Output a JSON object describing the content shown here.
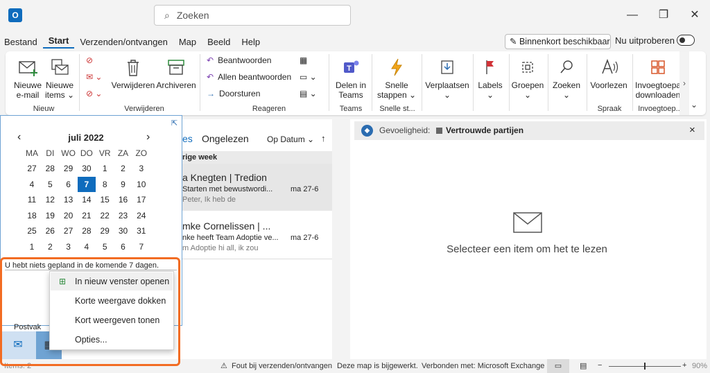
{
  "app": {
    "icon_letter": "O",
    "search_placeholder": "Zoeken"
  },
  "window": {
    "minimize": "—",
    "maximize": "❐",
    "close": "✕"
  },
  "menu": {
    "items": [
      "Bestand",
      "Start",
      "Verzenden/ontvangen",
      "Map",
      "Beeld",
      "Help"
    ],
    "active": "Start",
    "soon": "Binnenkort beschikbaar",
    "tryout": "Nu uitproberen"
  },
  "ribbon": {
    "new": {
      "new_email": "Nieuwe e-mail",
      "new_items": "Nieuwe items ⌄",
      "group": "Nieuw"
    },
    "delete": {
      "delete": "Verwijderen",
      "archive": "Archiveren",
      "group": "Verwijderen"
    },
    "respond": {
      "reply": "Beantwoorden",
      "reply_all": "Allen beantwoorden",
      "forward": "Doorsturen",
      "group": "Reageren"
    },
    "teams": {
      "share": "Delen in Teams",
      "group": "Teams"
    },
    "quicksteps": {
      "label": "Snelle stappen ⌄",
      "group": "Snelle st..."
    },
    "move": {
      "label": "Verplaatsen ⌄"
    },
    "tags": {
      "label": "Labels ⌄"
    },
    "groups": {
      "label": "Groepen ⌄"
    },
    "find": {
      "label": "Zoeken ⌄"
    },
    "speech": {
      "label": "Voorlezen",
      "group": "Spraak"
    },
    "addins": {
      "label": "Invoegtoepassingen downloaden",
      "group": "Invoegtoep..."
    }
  },
  "calendar": {
    "month": "juli 2022",
    "prev": "‹",
    "next": "›",
    "days": [
      "MA",
      "DI",
      "WO",
      "DO",
      "VR",
      "ZA",
      "ZO"
    ],
    "weeks": [
      [
        "27",
        "28",
        "29",
        "30",
        "1",
        "2",
        "3"
      ],
      [
        "4",
        "5",
        "6",
        "7",
        "8",
        "9",
        "10"
      ],
      [
        "11",
        "12",
        "13",
        "14",
        "15",
        "16",
        "17"
      ],
      [
        "18",
        "19",
        "20",
        "21",
        "22",
        "23",
        "24"
      ],
      [
        "25",
        "26",
        "27",
        "28",
        "29",
        "30",
        "31"
      ],
      [
        "1",
        "2",
        "3",
        "4",
        "5",
        "6",
        "7"
      ]
    ],
    "today": "7",
    "agenda": "U hebt niets gepland in de komende 7 dagen."
  },
  "maillist": {
    "tab_all": "es",
    "tab_unread": "Ongelezen",
    "sort": "Op Datum ⌄",
    "sort_dir": "↑",
    "section": "rige week",
    "items": [
      {
        "sender": "a Knegten | Tredion",
        "subject": "Starten met bewustwordi...",
        "date": "ma 27-6",
        "preview": "Peter,    Ik heb de"
      },
      {
        "sender": "mke Cornelissen | ...",
        "subject": "nke heeft Team Adoptie ve...",
        "date": "ma 27-6",
        "preview": "m Adoptie  hi all, ik zou"
      }
    ]
  },
  "reading": {
    "sensitivity_label": "Gevoeligheid:",
    "sensitivity_value": "Vertrouwde partijen",
    "close": "×",
    "empty": "Selecteer een item om het te lezen"
  },
  "nav": {
    "folder": "Postvak"
  },
  "context_menu": {
    "items": [
      "In nieuw venster openen",
      "Korte weergave dokken",
      "Kort weergeven tonen",
      "Opties..."
    ]
  },
  "status": {
    "items_count": "Items: 2",
    "error": "Fout bij verzenden/ontvangen",
    "updated": "Deze map is bijgewerkt.",
    "connected": "Verbonden met: Microsoft Exchange",
    "zoom": "90%"
  },
  "colors": {
    "accent": "#0f6cbd",
    "highlight": "#f26c23"
  }
}
